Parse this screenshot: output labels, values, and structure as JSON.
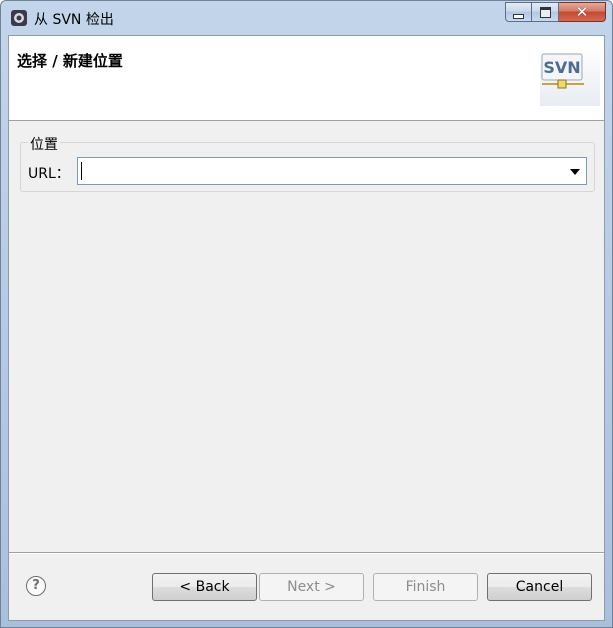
{
  "window": {
    "title": "从 SVN 检出",
    "controls": {
      "close": "✕"
    }
  },
  "banner": {
    "title": "选择 / 新建位置",
    "logo_text": "SVN"
  },
  "location_group": {
    "label": "位置",
    "url_label": "URL：",
    "url_value": ""
  },
  "footer": {
    "help_glyph": "?",
    "back_label": "< Back",
    "next_label": "Next >",
    "finish_label": "Finish",
    "cancel_label": "Cancel"
  },
  "colors": {
    "titlebar": "#b8cce4",
    "client_bg": "#f0f0f0",
    "close_button": "#c24a34"
  }
}
